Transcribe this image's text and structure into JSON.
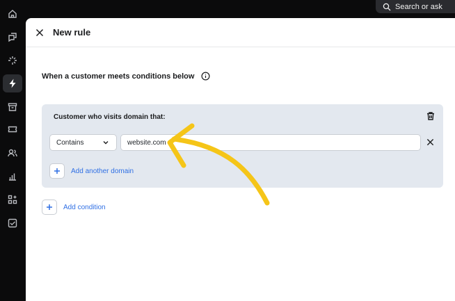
{
  "topbar": {
    "search_label": "Search or ask",
    "search_icon": "search-icon"
  },
  "sidebar": {
    "items": [
      {
        "icon": "home-icon"
      },
      {
        "icon": "chat-icon"
      },
      {
        "icon": "sparkle-icon"
      },
      {
        "icon": "lightning-icon",
        "active": true
      },
      {
        "icon": "archive-icon"
      },
      {
        "icon": "ticket-icon"
      },
      {
        "icon": "people-icon"
      },
      {
        "icon": "bar-chart-icon"
      },
      {
        "icon": "apps-icon"
      },
      {
        "icon": "checkbox-icon"
      }
    ]
  },
  "panel": {
    "title": "New rule",
    "condition_heading": "When a customer meets conditions below",
    "condition_group": {
      "title": "Customer who visits domain that:",
      "operator": "Contains",
      "value": "website.com",
      "add_domain_label": "Add another domain"
    },
    "add_condition_label": "Add condition"
  },
  "colors": {
    "accent": "#2f6fe4",
    "annotation": "#f5c518",
    "condition_bg": "#e3e8ef",
    "sidebar_bg": "#0b0b0c"
  }
}
